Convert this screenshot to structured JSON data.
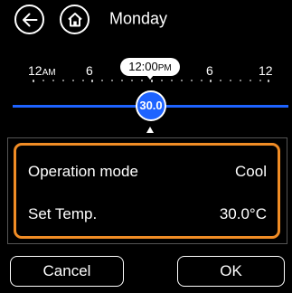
{
  "header": {
    "title": "Monday",
    "back_icon": "back-arrow-icon",
    "home_icon": "home-icon"
  },
  "timeline": {
    "ticks": [
      {
        "value": "12",
        "suffix": "AM"
      },
      {
        "value": "6",
        "suffix": ""
      },
      {
        "value": "6",
        "suffix": ""
      },
      {
        "value": "12",
        "suffix": ""
      }
    ],
    "current_time": {
      "value": "12:00",
      "suffix": "PM"
    },
    "set_point": "30.0",
    "line_color": "#1e63ff"
  },
  "settings": {
    "operation_mode": {
      "label": "Operation mode",
      "value": "Cool"
    },
    "set_temp": {
      "label": "Set Temp.",
      "value": "30.0°C"
    },
    "highlight_color": "#f08c25"
  },
  "buttons": {
    "cancel": "Cancel",
    "ok": "OK"
  }
}
